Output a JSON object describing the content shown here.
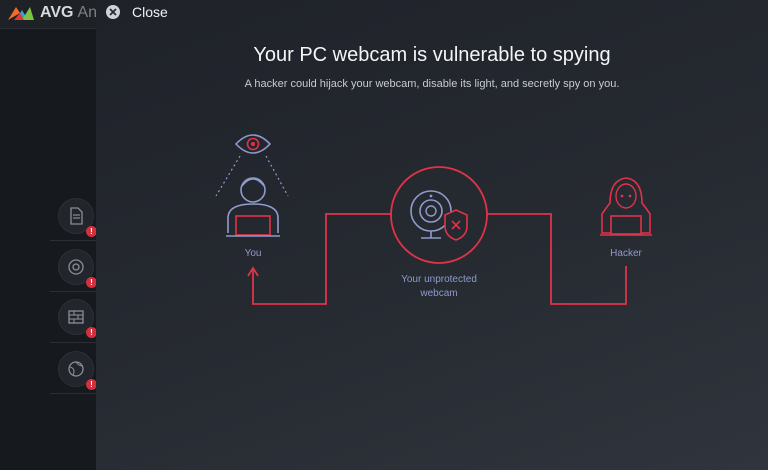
{
  "background_app": {
    "logo_text": "AVG",
    "title_fragment": "An",
    "badge_symbol": "!"
  },
  "close": {
    "label": "Close"
  },
  "heading": {
    "title": "Your PC webcam is vulnerable to spying",
    "subtitle": "A hacker could hijack your webcam, disable its light, and secretly spy on you."
  },
  "diagram": {
    "you_label": "You",
    "webcam_label_line1": "Your unprotected",
    "webcam_label_line2": "webcam",
    "hacker_label": "Hacker"
  },
  "colors": {
    "accent_red": "#e0334a",
    "line_blue": "#8f9bcc",
    "background": "#22262d"
  }
}
